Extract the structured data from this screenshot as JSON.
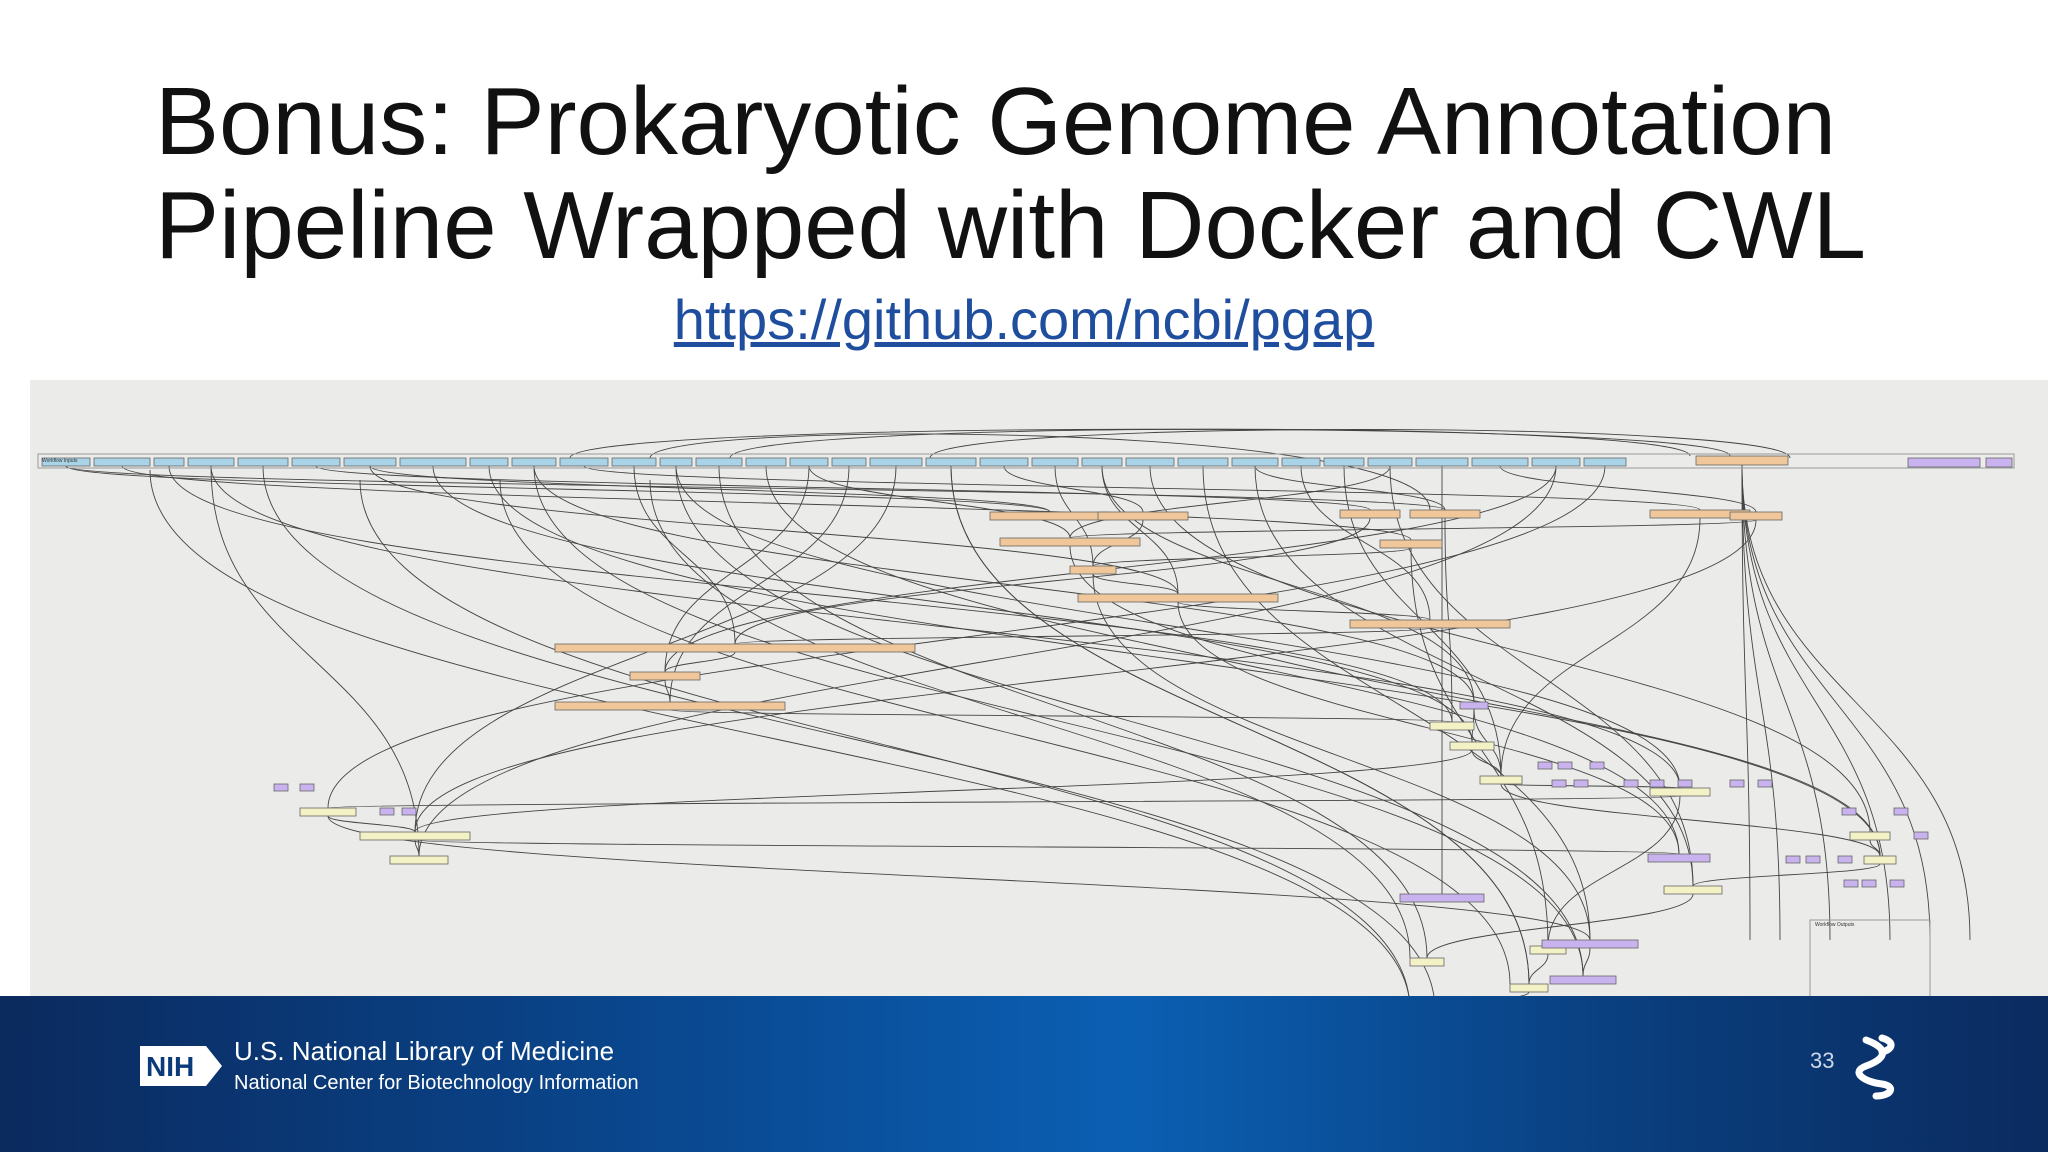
{
  "slide": {
    "title_line1": "Bonus: Prokaryotic Genome Annotation",
    "title_line2": "Pipeline Wrapped with Docker and CWL",
    "link": "https://github.com/ncbi/pgap",
    "page_number": "33"
  },
  "footer": {
    "logo_text": "NIH",
    "org_name": "U.S. National Library of Medicine",
    "sub_org": "National Center for Biotechnology Information"
  },
  "diagram": {
    "labels": {
      "workflow_inputs": "Workflow Inputs",
      "workflow_outputs": "Workflow Outputs"
    },
    "colors": {
      "input_node": "#a9d3e6",
      "step_node": "#f0c79a",
      "subworkflow_node": "#f3f1c6",
      "param_node": "#c9b3ee",
      "edge": "#444444"
    }
  },
  "colors": {
    "title": "#111111",
    "link": "#1f4e9e",
    "diagram_background": "#ebebea"
  }
}
